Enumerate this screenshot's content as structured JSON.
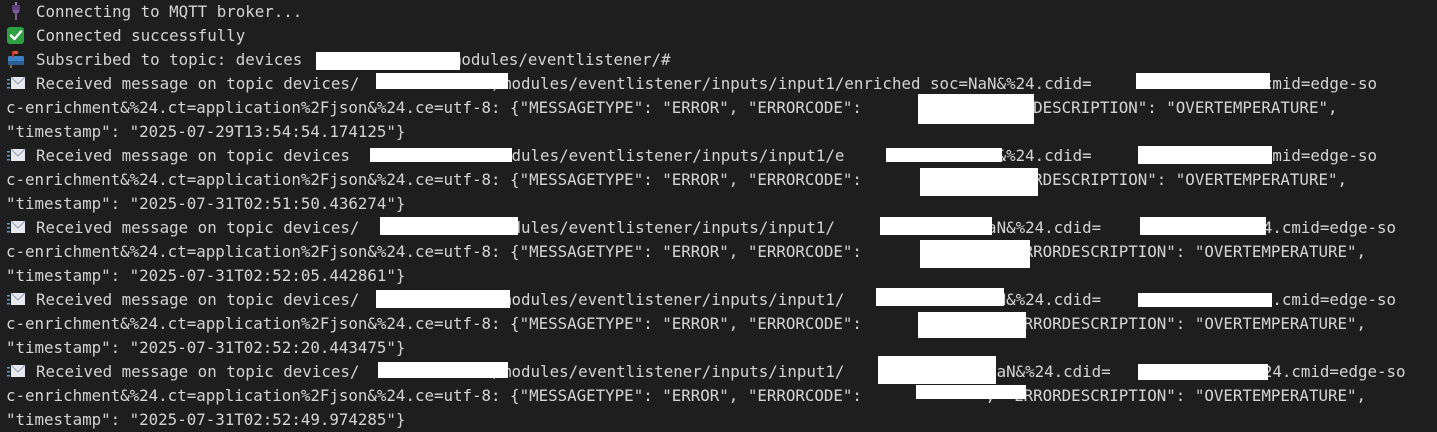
{
  "lines": {
    "connecting": "Connecting to MQTT broker...",
    "connected": "Connected successfully",
    "subscribed_a": "Subscribed to topic: devices",
    "subscribed_b": "/modules/eventlistener/#"
  },
  "messages": [
    {
      "l1": "Received message on topic devices/              /modules/eventlistener/inputs/input1/enriched soc=NaN&%24.cdid=              %24.cmid=edge-so",
      "l2": "c-enrichment&%24.ct=application%2Fjson&%24.ce=utf-8: {\"MESSAGETYPE\": \"ERROR\", \"ERRORCODE\":            \"ERRORDESCRIPTION\": \"OVERTEMPERATURE\",",
      "l3": "\"timestamp\": \"2025-07-29T13:54:54.174125\"}"
    },
    {
      "l1": "Received message on topic devices               modules/eventlistener/inputs/input1/e             NaN&%24.cdid=              %24.cmid=edge-so",
      "l2": "c-enrichment&%24.ct=application%2Fjson&%24.ce=utf-8: {\"MESSAGETYPE\": \"ERROR\", \"ERRORCODE\":             \"ERRORDESCRIPTION\": \"OVERTEMPERATURE\",",
      "l3": "\"timestamp\": \"2025-07-31T02:51:50.436274\"}"
    },
    {
      "l1": "Received message on topic devices/              modules/eventlistener/inputs/input1/              =NaN&%24.cdid=               %24.cmid=edge-so",
      "l2": "c-enrichment&%24.ct=application%2Fjson&%24.ce=utf-8: {\"MESSAGETYPE\": \"ERROR\", \"ERRORCODE\":             , \"ERRORDESCRIPTION\": \"OVERTEMPERATURE\",",
      "l3": "\"timestamp\": \"2025-07-31T02:52:05.442861\"}"
    },
    {
      "l1": "Received message on topic devices/              /modules/eventlistener/inputs/input1/              NaN&%24.cdid=               %24.cmid=edge-so",
      "l2": "c-enrichment&%24.ct=application%2Fjson&%24.ce=utf-8: {\"MESSAGETYPE\": \"ERROR\", \"ERRORCODE\":             , \"ERRORDESCRIPTION\": \"OVERTEMPERATURE\",",
      "l3": "\"timestamp\": \"2025-07-31T02:52:20.443475\"}"
    },
    {
      "l1": "Received message on topic devices/              /modules/eventlistener/inputs/input1/              =NaN&%24.cdid=               %24.cmid=edge-so",
      "l2": "c-enrichment&%24.ct=application%2Fjson&%24.ce=utf-8: {\"MESSAGETYPE\": \"ERROR\", \"ERRORCODE\":             , \"ERRORDESCRIPTION\": \"OVERTEMPERATURE\",",
      "l3": "\"timestamp\": \"2025-07-31T02:52:49.974285\"}"
    }
  ],
  "icons": {
    "connecting": "plug-icon",
    "connected": "check-icon",
    "subscribed": "mailbox-icon",
    "message": "envelope-icon"
  },
  "colors": {
    "background": "#1e1e1e",
    "text": "#d4d4d4",
    "check_green": "#2ea043",
    "redaction": "#ffffff"
  }
}
